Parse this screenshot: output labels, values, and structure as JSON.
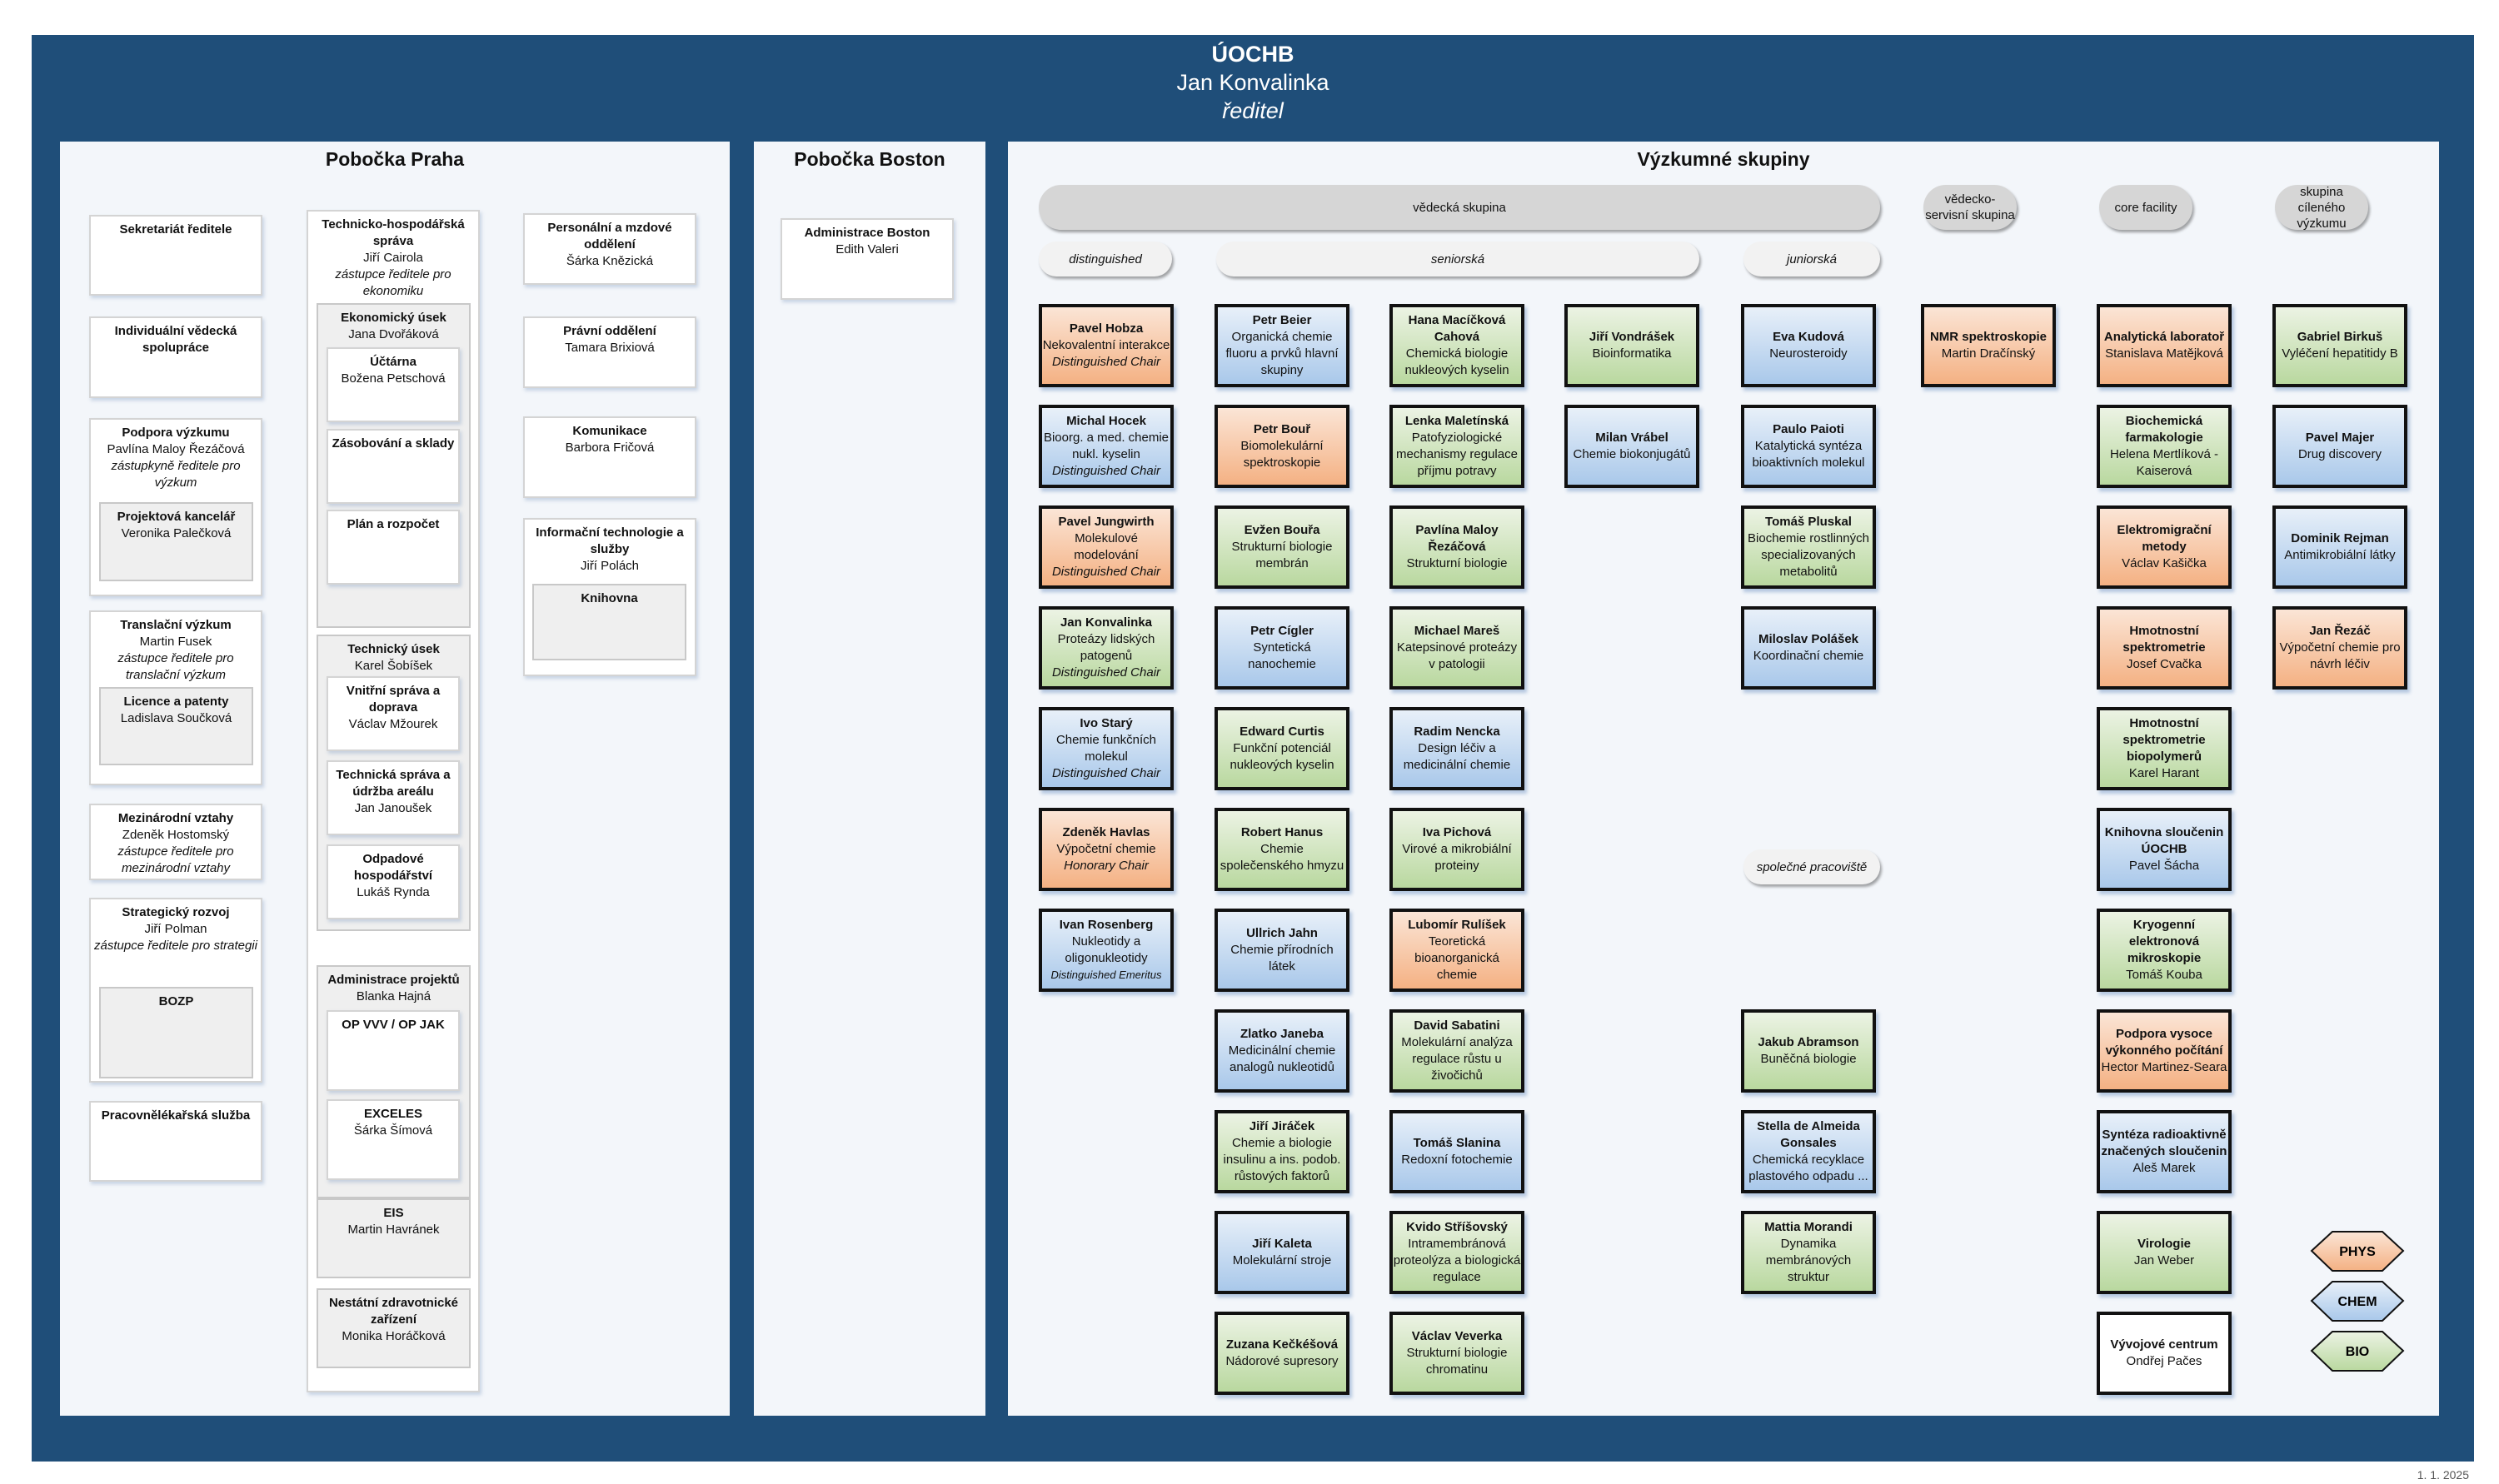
{
  "header": {
    "org": "ÚOCHB",
    "director": "Jan Konvalinka",
    "role": "ředitel"
  },
  "praha": {
    "title": "Pobočka Praha",
    "left_column": [
      {
        "title": "Sekretariát ředitele"
      },
      {
        "title": "Individuální vědecká spolupráce"
      },
      {
        "title": "Podpora výzkumu",
        "person": "Pavlína Maloy Řezáčová",
        "role": "zástupkyně ředitele pro výzkum",
        "children": [
          {
            "title": "Projektová kancelář",
            "person": "Veronika Palečková"
          }
        ]
      },
      {
        "title": "Translační výzkum",
        "person": "Martin Fusek",
        "role": "zástupce ředitele pro translační výzkum",
        "children": [
          {
            "title": "Licence a patenty",
            "person": "Ladislava Součková"
          }
        ]
      },
      {
        "title": "Mezinárodní vztahy",
        "person": "Zdeněk Hostomský",
        "role": "zástupce ředitele pro mezinárodní vztahy"
      },
      {
        "title": "Strategický rozvoj",
        "person": "Jiří Polman",
        "role": "zástupce ředitele pro strategii",
        "children": [
          {
            "title": "BOZP"
          }
        ]
      },
      {
        "title": "Pracovnělékařská služba"
      }
    ],
    "ths": {
      "title": "Technicko-hospodářská správa",
      "person": "Jiří Cairola",
      "role": "zástupce ředitele pro ekonomiku",
      "sections": [
        {
          "title": "Ekonomický úsek",
          "person": "Jana Dvořáková",
          "children": [
            {
              "title": "Účtárna",
              "person": "Božena Petschová"
            },
            {
              "title": "Zásobování a sklady"
            },
            {
              "title": "Plán a rozpočet"
            }
          ]
        },
        {
          "title": "Technický úsek",
          "person": "Karel Šobíšek",
          "children": [
            {
              "title": "Vnitřní správa a doprava",
              "person": "Václav Mžourek"
            },
            {
              "title": "Technická správa a údržba areálu",
              "person": "Jan Janoušek"
            },
            {
              "title": "Odpadové hospodářství",
              "person": "Lukáš Rynda"
            }
          ]
        },
        {
          "title": "Administrace projektů",
          "person": "Blanka Hajná",
          "children": [
            {
              "title": "OP VVV / OP JAK"
            },
            {
              "title": "EXCELES",
              "person": "Šárka Šímová"
            }
          ]
        },
        {
          "title": "EIS",
          "person": "Martin Havránek"
        },
        {
          "title": "Nestátní zdravotnické zařízení",
          "person": "Monika Horáčková"
        }
      ]
    },
    "right_column": [
      {
        "title": "Personální a mzdové oddělení",
        "person": "Šárka Knězická"
      },
      {
        "title": "Právní oddělení",
        "person": "Tamara Brixiová"
      },
      {
        "title": "Komunikace",
        "person": "Barbora Fričová"
      },
      {
        "title": "Informační technologie a služby",
        "person": "Jiří Polách",
        "children": [
          {
            "title": "Knihovna"
          }
        ]
      }
    ]
  },
  "boston": {
    "title": "Pobočka Boston",
    "boxes": [
      {
        "title": "Administrace Boston",
        "person": "Edith Valeri"
      }
    ]
  },
  "research": {
    "title": "Výzkumné skupiny",
    "categories": {
      "scientific": "vědecká skupina",
      "service": "vědecko-servisní skupina",
      "core": "core facility",
      "targeted": "skupina cíleného výzkumu"
    },
    "subcategories": {
      "distinguished": "distinguished",
      "senior": "seniorská",
      "junior": "juniorská",
      "joint": "společné pracoviště"
    },
    "distinguished": [
      {
        "name": "Pavel Hobza",
        "topic": "Nekovalentní interakce",
        "title": "Distinguished Chair",
        "field": "phys"
      },
      {
        "name": "Michal Hocek",
        "topic": "Bioorg. a med. chemie nukl. kyselin",
        "title": "Distinguished Chair",
        "field": "chem"
      },
      {
        "name": "Pavel Jungwirth",
        "topic": "Molekulové modelování",
        "title": "Distinguished Chair",
        "field": "phys"
      },
      {
        "name": "Jan Konvalinka",
        "topic": "Proteázy lidských patogenů",
        "title": "Distinguished Chair",
        "field": "bio"
      },
      {
        "name": "Ivo Starý",
        "topic": "Chemie funkčních molekul",
        "title": "Distinguished Chair",
        "field": "chem"
      },
      {
        "name": "Zdeněk Havlas",
        "topic": "Výpočetní chemie",
        "title": "Honorary Chair",
        "field": "phys"
      },
      {
        "name": "Ivan Rosenberg",
        "topic": "Nukleotidy a oligonukleotidy",
        "title": "Distinguished Emeritus",
        "field": "chem",
        "small_title": true
      }
    ],
    "senior_col1": [
      {
        "name": "Petr Beier",
        "topic": "Organická chemie fluoru a prvků hlavní skupiny",
        "field": "chem"
      },
      {
        "name": "Petr Bouř",
        "topic": "Biomolekulární spektroskopie",
        "field": "phys"
      },
      {
        "name": "Evžen Bouřa",
        "topic": "Strukturní biologie membrán",
        "field": "bio"
      },
      {
        "name": "Petr Cígler",
        "topic": "Syntetická nanochemie",
        "field": "chem"
      },
      {
        "name": "Edward Curtis",
        "topic": "Funkční potenciál nukleových kyselin",
        "field": "bio"
      },
      {
        "name": "Robert Hanus",
        "topic": "Chemie společenského hmyzu",
        "field": "bio"
      },
      {
        "name": "Ullrich Jahn",
        "topic": "Chemie přírodních látek",
        "field": "chem"
      },
      {
        "name": "Zlatko Janeba",
        "topic": "Medicinální chemie analogů nukleotidů",
        "field": "chem"
      },
      {
        "name": "Jiří Jiráček",
        "topic": "Chemie a biologie insulinu a ins. podob. růstových faktorů",
        "field": "bio"
      },
      {
        "name": "Jiří Kaleta",
        "topic": "Molekulární stroje",
        "field": "chem"
      },
      {
        "name": "Zuzana Kečkéšová",
        "topic": "Nádorové supresory",
        "field": "bio"
      }
    ],
    "senior_col2": [
      {
        "name": "Hana Macíčková Cahová",
        "topic": "Chemická biologie nukleových kyselin",
        "field": "bio"
      },
      {
        "name": "Lenka Maletínská",
        "topic": "Patofyziologické mechanismy regulace příjmu potravy",
        "field": "bio"
      },
      {
        "name": "Pavlína Maloy Řezáčová",
        "topic": "Strukturní biologie",
        "field": "bio"
      },
      {
        "name": "Michael Mareš",
        "topic": "Katepsinové proteázy v patologii",
        "field": "bio"
      },
      {
        "name": "Radim Nencka",
        "topic": "Design léčiv a medicinální chemie",
        "field": "chem"
      },
      {
        "name": "Iva Pichová",
        "topic": "Virové a mikrobiální proteiny",
        "field": "bio"
      },
      {
        "name": "Lubomír Rulíšek",
        "topic": "Teoretická bioanorganická chemie",
        "field": "phys"
      },
      {
        "name": "David Sabatini",
        "topic": "Molekulární analýza regulace růstu u živočichů",
        "field": "bio"
      },
      {
        "name": "Tomáš Slanina",
        "topic": "Redoxní fotochemie",
        "field": "chem"
      },
      {
        "name": "Kvido Stříšovský",
        "topic": "Intramembránová proteolýza a biologická regulace",
        "field": "bio"
      },
      {
        "name": "Václav Veverka",
        "topic": "Strukturní biologie chromatinu",
        "field": "bio"
      }
    ],
    "senior_col3": [
      {
        "name": "Jiří Vondrášek",
        "topic": "Bioinformatika",
        "field": "bio"
      },
      {
        "name": "Milan Vrábel",
        "topic": "Chemie biokonjugátů",
        "field": "chem"
      }
    ],
    "junior": [
      {
        "name": "Eva Kudová",
        "topic": "Neurosteroidy",
        "field": "chem"
      },
      {
        "name": "Paulo Paioti",
        "topic": "Katalytická syntéza bioaktivních molekul",
        "field": "chem"
      },
      {
        "name": "Tomáš Pluskal",
        "topic": "Biochemie rostlinných specializovaných metabolitů",
        "field": "bio"
      },
      {
        "name": "Miloslav Polášek",
        "topic": "Koordinační chemie",
        "field": "chem"
      }
    ],
    "joint": [
      {
        "name": "Jakub Abramson",
        "topic": "Buněčná biologie",
        "field": "bio"
      },
      {
        "name": "Stella de Almeida Gonsales",
        "topic": "Chemická recyklace plastového odpadu ...",
        "field": "chem"
      },
      {
        "name": "Mattia Morandi",
        "topic": "Dynamika membránových struktur",
        "field": "bio"
      }
    ],
    "service": [
      {
        "name": "NMR spektroskopie",
        "topic": "Martin Dračínský",
        "field": "phys"
      }
    ],
    "core_facility": [
      {
        "name": "Analytická laboratoř",
        "topic": "Stanislava Matějková",
        "field": "phys"
      },
      {
        "name": "Biochemická farmakologie",
        "topic": "Helena Mertlíková - Kaiserová",
        "field": "bio"
      },
      {
        "name": "Elektromigrační metody",
        "topic": "Václav Kašička",
        "field": "phys"
      },
      {
        "name": "Hmotnostní spektrometrie",
        "topic": "Josef Cvačka",
        "field": "phys"
      },
      {
        "name": "Hmotnostní spektrometrie biopolymerů",
        "topic": "Karel Harant",
        "field": "bio"
      },
      {
        "name": "Knihovna sloučenin ÚOCHB",
        "topic": "Pavel Šácha",
        "field": "chem"
      },
      {
        "name": "Kryogenní elektronová mikroskopie",
        "topic": "Tomáš Kouba",
        "field": "bio"
      },
      {
        "name": "Podpora vysoce výkonného počítání",
        "topic": "Hector Martinez-Seara",
        "field": "phys"
      },
      {
        "name": "Syntéza radioaktivně značených sloučenin",
        "topic": "Aleš Marek",
        "field": "chem"
      },
      {
        "name": "Virologie",
        "topic": "Jan Weber",
        "field": "bio"
      },
      {
        "name": "Vývojové centrum",
        "topic": "Ondřej Pačes",
        "field": "white"
      }
    ],
    "targeted": [
      {
        "name": "Gabriel Birkuš",
        "topic": "Vyléčení hepatitidy B",
        "field": "bio"
      },
      {
        "name": "Pavel Majer",
        "topic": "Drug discovery",
        "field": "chem"
      },
      {
        "name": "Dominik Rejman",
        "topic": "Antimikrobiální látky",
        "field": "chem"
      },
      {
        "name": "Jan Řezáč",
        "topic": "Výpočetní chemie pro návrh léčiv",
        "field": "phys"
      }
    ]
  },
  "legend": [
    {
      "label": "PHYS",
      "field": "phys"
    },
    {
      "label": "CHEM",
      "field": "chem"
    },
    {
      "label": "BIO",
      "field": "bio"
    }
  ],
  "footer": {
    "date": "1. 1. 2025"
  }
}
